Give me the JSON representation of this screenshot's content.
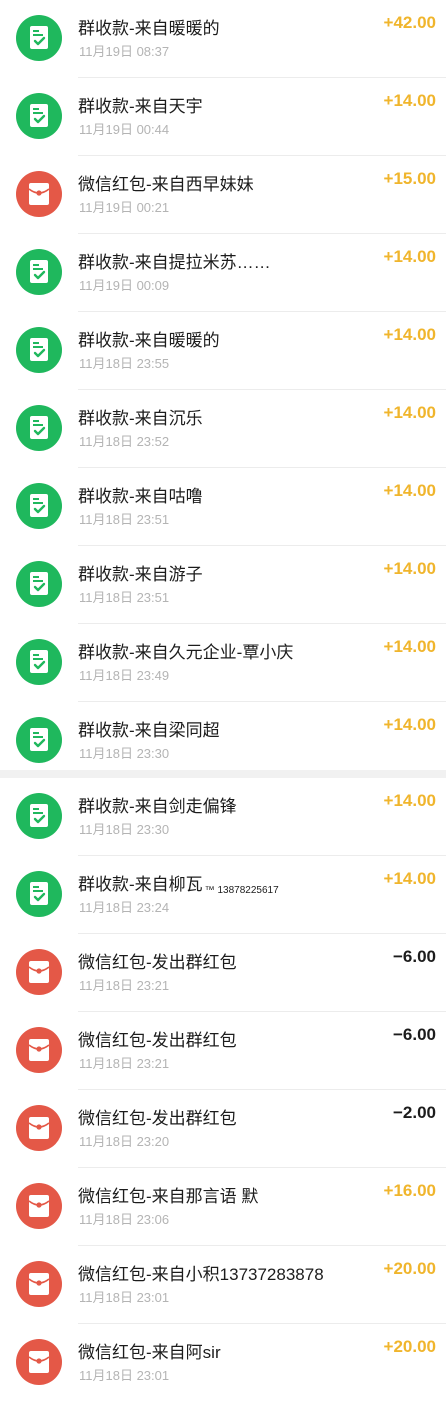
{
  "colors": {
    "income_amount": "#f0b52c",
    "expense_amount": "#1c1c1c",
    "group_receipt_icon_bg": "#1fb85d",
    "red_packet_icon_bg": "#e45847"
  },
  "transactions_top": [
    {
      "icon": "group-receipt-icon",
      "title": "群收款-来自暖暖的",
      "suffix": "",
      "time": "11月19日 08:37",
      "amount": "+42.00",
      "sign": "pos"
    },
    {
      "icon": "group-receipt-icon",
      "title": "群收款-来自天宇",
      "suffix": "",
      "time": "11月19日 00:44",
      "amount": "+14.00",
      "sign": "pos"
    },
    {
      "icon": "red-packet-icon",
      "title": "微信红包-来自西早妹妹",
      "suffix": "",
      "time": "11月19日 00:21",
      "amount": "+15.00",
      "sign": "pos"
    },
    {
      "icon": "group-receipt-icon",
      "title": "群收款-来自提拉米苏……",
      "suffix": "",
      "time": "11月19日 00:09",
      "amount": "+14.00",
      "sign": "pos"
    },
    {
      "icon": "group-receipt-icon",
      "title": "群收款-来自暖暖的",
      "suffix": "",
      "time": "11月18日 23:55",
      "amount": "+14.00",
      "sign": "pos"
    },
    {
      "icon": "group-receipt-icon",
      "title": "群收款-来自沉乐",
      "suffix": "",
      "time": "11月18日 23:52",
      "amount": "+14.00",
      "sign": "pos"
    },
    {
      "icon": "group-receipt-icon",
      "title": "群收款-来自咕噜",
      "suffix": "",
      "time": "11月18日 23:51",
      "amount": "+14.00",
      "sign": "pos"
    },
    {
      "icon": "group-receipt-icon",
      "title": "群收款-来自游子",
      "suffix": "",
      "time": "11月18日 23:51",
      "amount": "+14.00",
      "sign": "pos"
    },
    {
      "icon": "group-receipt-icon",
      "title": "群收款-来自久元企业-覃小庆",
      "suffix": "",
      "time": "11月18日 23:49",
      "amount": "+14.00",
      "sign": "pos"
    },
    {
      "icon": "group-receipt-icon",
      "title": "群收款-来自梁同超",
      "suffix": "",
      "time": "11月18日 23:30",
      "amount": "+14.00",
      "sign": "pos"
    }
  ],
  "transactions_bottom": [
    {
      "icon": "group-receipt-icon",
      "title": "群收款-来自剑走偏锋",
      "suffix": "",
      "time": "11月18日 23:30",
      "amount": "+14.00",
      "sign": "pos"
    },
    {
      "icon": "group-receipt-icon",
      "title": "群收款-来自柳瓦",
      "suffix": "™ 13878225617",
      "time": "11月18日 23:24",
      "amount": "+14.00",
      "sign": "pos"
    },
    {
      "icon": "red-packet-icon",
      "title": "微信红包-发出群红包",
      "suffix": "",
      "time": "11月18日 23:21",
      "amount": "−6.00",
      "sign": "neg"
    },
    {
      "icon": "red-packet-icon",
      "title": "微信红包-发出群红包",
      "suffix": "",
      "time": "11月18日 23:21",
      "amount": "−6.00",
      "sign": "neg"
    },
    {
      "icon": "red-packet-icon",
      "title": "微信红包-发出群红包",
      "suffix": "",
      "time": "11月18日 23:20",
      "amount": "−2.00",
      "sign": "neg"
    },
    {
      "icon": "red-packet-icon",
      "title": "微信红包-来自那言语 默",
      "suffix": "",
      "time": "11月18日 23:06",
      "amount": "+16.00",
      "sign": "pos"
    },
    {
      "icon": "red-packet-icon",
      "title": "微信红包-来自小积13737283878",
      "suffix": "",
      "time": "11月18日 23:01",
      "amount": "+20.00",
      "sign": "pos"
    },
    {
      "icon": "red-packet-icon",
      "title": "微信红包-来自阿sir",
      "suffix": "",
      "time": "11月18日 23:01",
      "amount": "+20.00",
      "sign": "pos"
    }
  ]
}
